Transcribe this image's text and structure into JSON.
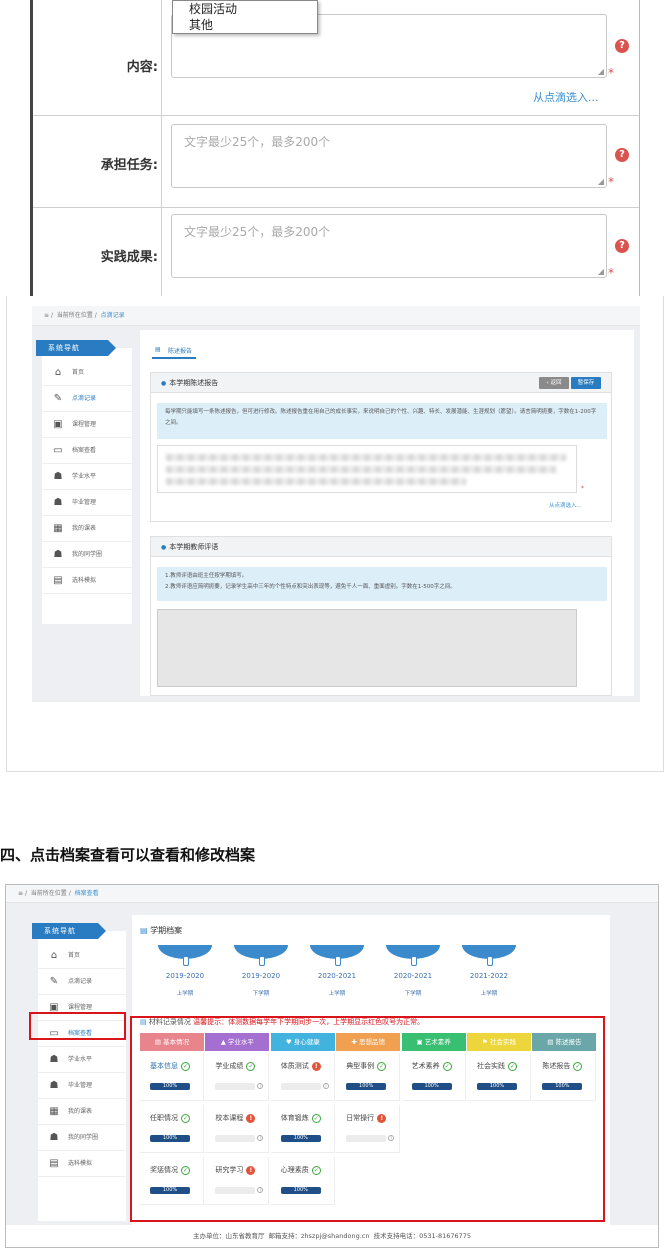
{
  "form": {
    "dropdown_options": [
      "校园活动",
      "其他"
    ],
    "content_label": "内容:",
    "from_pick_link": "从点滴选入...",
    "task_label": "承担任务:",
    "task_placeholder": "文字最少25个，最多200个",
    "result_label": "实践成果:",
    "result_placeholder": "文字最少25个，最多200个",
    "help_glyph": "?",
    "required_mark": "*"
  },
  "shot2": {
    "breadcrumb": [
      "≡",
      "当前所在位置",
      "/",
      "点滴记录"
    ],
    "nav_title": "系统导航",
    "nav_items": [
      "首页",
      "点滴记录",
      "课程管理",
      "档案查看",
      "学业水平",
      "毕业管理",
      "我的课表",
      "我的同学圈",
      "选科模拟"
    ],
    "tab": "陈述报告",
    "panel1_title": "本学期陈述报告",
    "back_button": "‹ 返回",
    "save_button": "暂保存",
    "panel1_hint": "每学期只能填写一条陈述报告，但可进行修改。陈述报告重在用自己的成长事实，来说明自己的个性、兴趣、特长、发展潜能、生涯规划（愿望）。请言简明扼要，字数在1-200字之间。",
    "panel1_link": "从点滴选入...",
    "panel2_title": "本学期教师评语",
    "panel2_hint_line1": "1.教师评语由班主任按学期填写。",
    "panel2_hint_line2": "2.教师评语应简明扼要，记录学生高中三年的个性特点和突出表现等，避免千人一面、重面虚别。字数在1-500字之间。"
  },
  "heading": "四、点击档案查看可以查看和修改档案",
  "shot3": {
    "breadcrumb": [
      "≡",
      "当前所在位置",
      "/",
      "档案查看"
    ],
    "nav_title": "系统导航",
    "nav_items": [
      "首页",
      "点滴记录",
      "课程管理",
      "档案查看",
      "学业水平",
      "毕业管理",
      "我的课表",
      "我的同学圈",
      "选科模拟"
    ],
    "section_title": "学期档案",
    "semesters": [
      {
        "year": "2019-2020",
        "term": "上学期"
      },
      {
        "year": "2019-2020",
        "term": "下学期"
      },
      {
        "year": "2020-2021",
        "term": "上学期"
      },
      {
        "year": "2020-2021",
        "term": "下学期"
      },
      {
        "year": "2021-2022",
        "term": "上学期"
      }
    ],
    "record_title": "材料记录情况",
    "record_tip": "温馨提示：体测数据每学年下学期同步一次，上学期显示红色叹号为正常。",
    "categories": [
      {
        "label": "基本情况",
        "color": "#e8848c"
      },
      {
        "label": "学业水平",
        "color": "#a46fd0"
      },
      {
        "label": "身心健康",
        "color": "#41b3de"
      },
      {
        "label": "思想品德",
        "color": "#f0a050"
      },
      {
        "label": "艺术素养",
        "color": "#39bf72"
      },
      {
        "label": "社会实践",
        "color": "#ecd63b"
      },
      {
        "label": "陈述报告",
        "color": "#6ba7a8"
      }
    ],
    "cells": [
      {
        "name": "基本信息",
        "status": "ok",
        "progress": "100%",
        "highlight": true
      },
      {
        "name": "学业成绩",
        "status": "ok",
        "progress": ""
      },
      {
        "name": "体质测试",
        "status": "bad",
        "progress": ""
      },
      {
        "name": "典型事例",
        "status": "ok",
        "progress": "100%"
      },
      {
        "name": "艺术素养",
        "status": "ok",
        "progress": "100%"
      },
      {
        "name": "社会实践",
        "status": "ok",
        "progress": "100%"
      },
      {
        "name": "陈述报告",
        "status": "ok",
        "progress": "100%"
      },
      {
        "name": "任职情况",
        "status": "ok",
        "progress": "100%"
      },
      {
        "name": "校本课程",
        "status": "bad",
        "progress": ""
      },
      {
        "name": "体育锻炼",
        "status": "ok",
        "progress": "100%"
      },
      {
        "name": "日常操行",
        "status": "bad",
        "progress": ""
      },
      {
        "name": "奖惩情况",
        "status": "ok",
        "progress": "100%"
      },
      {
        "name": "研究学习",
        "status": "bad",
        "progress": ""
      },
      {
        "name": "心理素质",
        "status": "ok",
        "progress": "100%"
      }
    ],
    "footer": "主办单位：山东省教育厅    邮箱支持：zhszpj@shandong.cn    技术支持电话：0531-81676775"
  }
}
